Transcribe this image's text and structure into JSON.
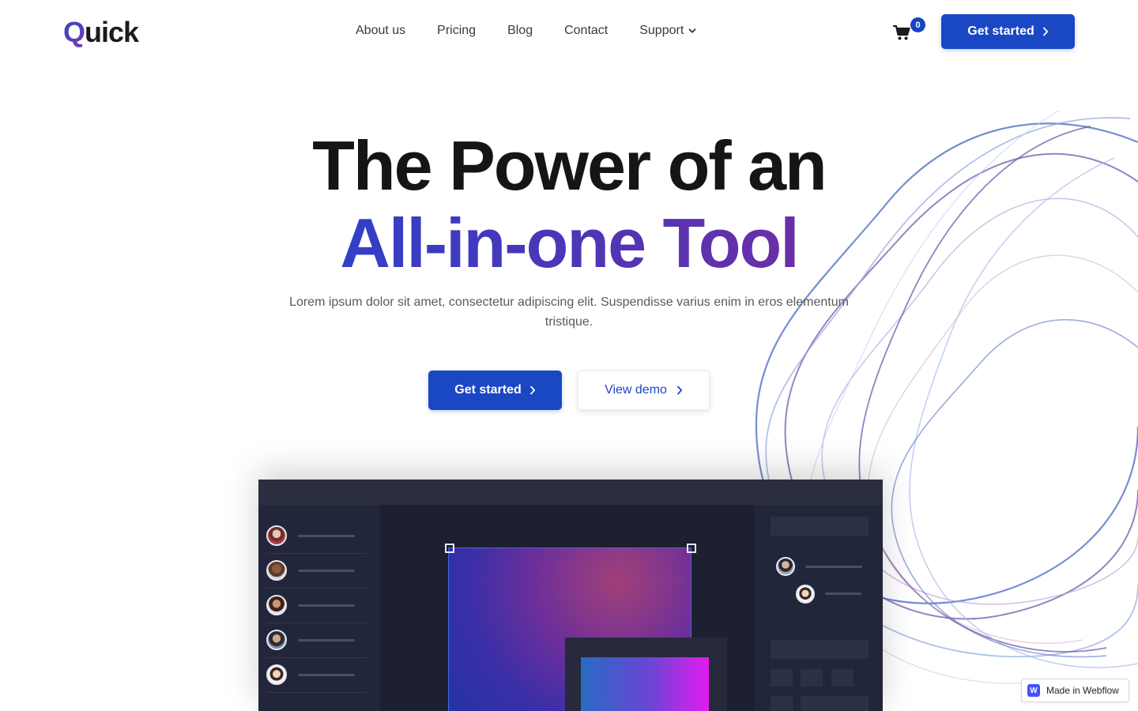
{
  "brand": {
    "logo_q": "Q",
    "logo_rest": "uick"
  },
  "nav": {
    "items": [
      {
        "label": "About us"
      },
      {
        "label": "Pricing"
      },
      {
        "label": "Blog"
      },
      {
        "label": "Contact"
      },
      {
        "label": "Support"
      }
    ],
    "cart_count": "0",
    "cta_label": "Get started"
  },
  "hero": {
    "title_line1": "The Power of an",
    "title_line2": "All-in-one Tool",
    "lead": "Lorem ipsum dolor sit amet, consectetur adipiscing elit. Suspendisse varius enim in eros elementum tristique.",
    "primary_cta": "Get started",
    "secondary_cta": "View demo"
  },
  "badge": {
    "label": "Made in Webflow",
    "icon_letter": "W"
  },
  "colors": {
    "accent": "#1a47c4",
    "gradient_start": "#3140c8",
    "gradient_end": "#6a2fa8",
    "app_bg": "#1c2030"
  },
  "icons": [
    "cart-icon",
    "chevron-down-icon",
    "chevron-right-icon",
    "webflow-icon"
  ]
}
